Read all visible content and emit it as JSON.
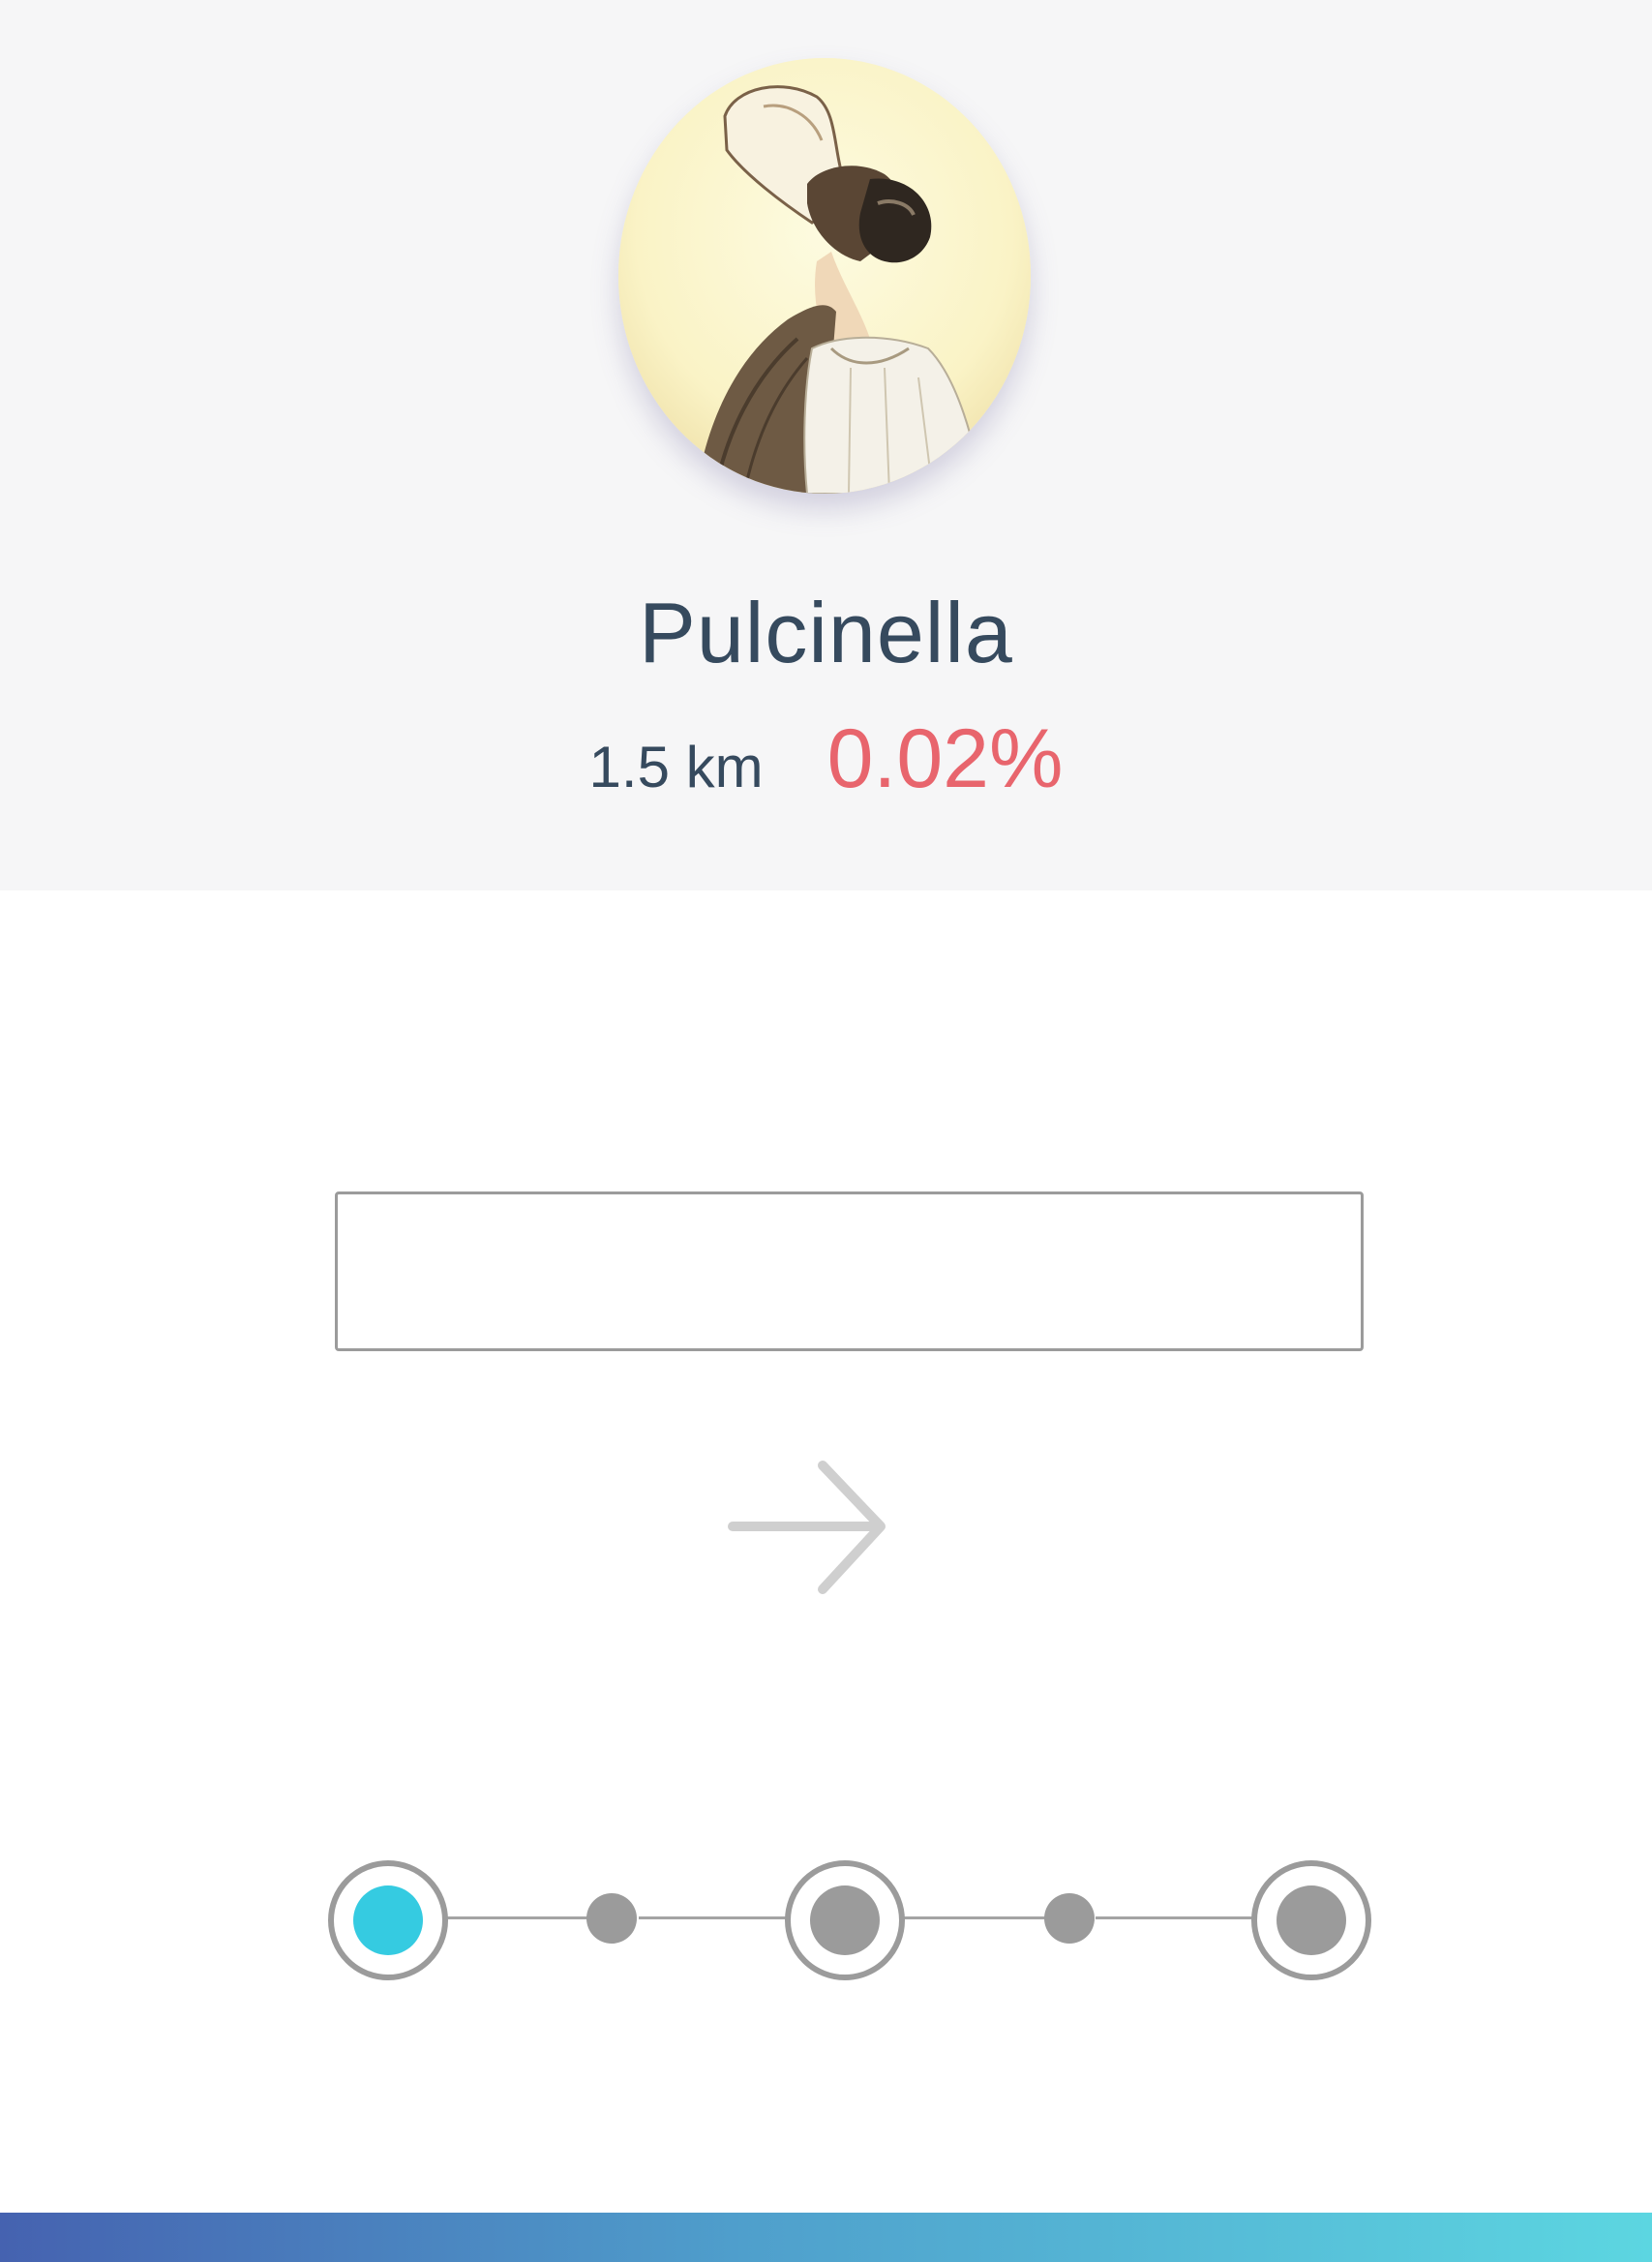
{
  "profile": {
    "name": "Pulcinella",
    "distance": "1.5 km",
    "percentage": "0.02%",
    "avatar_alt": "Pulcinella portrait"
  },
  "answer": {
    "value": "",
    "placeholder": ""
  },
  "next_button": {
    "icon": "arrow-right-icon",
    "label": "Next"
  },
  "progress": {
    "current_step": 1,
    "total_major_steps": 3,
    "steps": [
      {
        "type": "major",
        "state": "active"
      },
      {
        "type": "minor",
        "state": "inactive"
      },
      {
        "type": "major",
        "state": "inactive"
      },
      {
        "type": "minor",
        "state": "inactive"
      },
      {
        "type": "major",
        "state": "inactive"
      }
    ]
  },
  "colors": {
    "header_bg": "#f6f6f7",
    "text": "#364a5e",
    "percentage": "#e8656d",
    "active_step": "#35cbe1",
    "inactive_step": "#9b9b9b",
    "arrow": "#cfcfcf",
    "gradient_start": "#4562b0",
    "gradient_end": "#5cd6e1"
  }
}
